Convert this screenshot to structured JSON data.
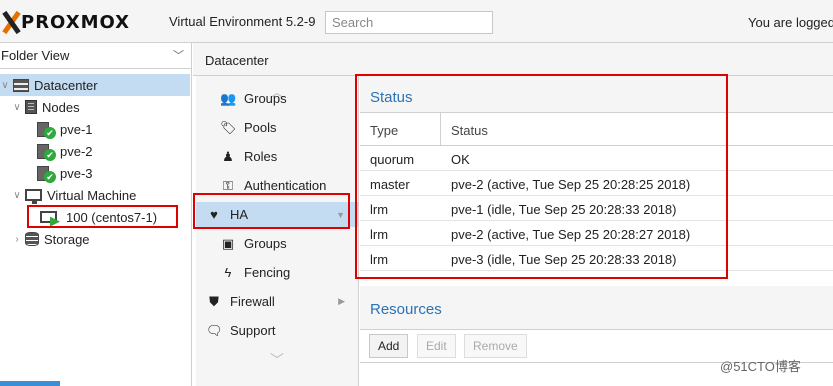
{
  "header": {
    "logo_text": "PROXMOX",
    "version": "Virtual Environment 5.2-9",
    "search_placeholder": "Search",
    "user_text": "You are logged"
  },
  "tree": {
    "view_label": "Folder View",
    "items": [
      {
        "label": "Datacenter"
      },
      {
        "label": "Nodes"
      },
      {
        "label": "pve-1"
      },
      {
        "label": "pve-2"
      },
      {
        "label": "pve-3"
      },
      {
        "label": "Virtual Machine"
      },
      {
        "label": "100 (centos7-1)"
      },
      {
        "label": "Storage"
      }
    ]
  },
  "breadcrumb": "Datacenter",
  "nav": {
    "items": [
      {
        "label": "Groups",
        "icon": "groups-icon"
      },
      {
        "label": "Pools",
        "icon": "tag-icon"
      },
      {
        "label": "Roles",
        "icon": "person-icon"
      },
      {
        "label": "Authentication",
        "icon": "key-icon"
      },
      {
        "label": "HA",
        "icon": "heartbeat-icon"
      },
      {
        "label": "Groups",
        "icon": "server-group-icon"
      },
      {
        "label": "Fencing",
        "icon": "bolt-icon"
      },
      {
        "label": "Firewall",
        "icon": "shield-icon"
      },
      {
        "label": "Support",
        "icon": "chat-icon"
      }
    ]
  },
  "status": {
    "title": "Status",
    "columns": [
      "Type",
      "Status"
    ],
    "rows": [
      {
        "type": "quorum",
        "status": "OK"
      },
      {
        "type": "master",
        "status": "pve-2 (active, Tue Sep 25 20:28:25 2018)"
      },
      {
        "type": "lrm",
        "status": "pve-1 (idle, Tue Sep 25 20:28:33 2018)"
      },
      {
        "type": "lrm",
        "status": "pve-2 (active, Tue Sep 25 20:28:27 2018)"
      },
      {
        "type": "lrm",
        "status": "pve-3 (idle, Tue Sep 25 20:28:33 2018)"
      }
    ]
  },
  "resources": {
    "title": "Resources",
    "buttons": {
      "add": "Add",
      "edit": "Edit",
      "remove": "Remove"
    }
  },
  "watermark": "@51CTO博客",
  "colors": {
    "accent": "#2a72b5",
    "selection": "#c3dcf2",
    "highlight_box": "#e00000",
    "ok_green": "#2eaa3c",
    "logo_orange": "#e57000"
  }
}
